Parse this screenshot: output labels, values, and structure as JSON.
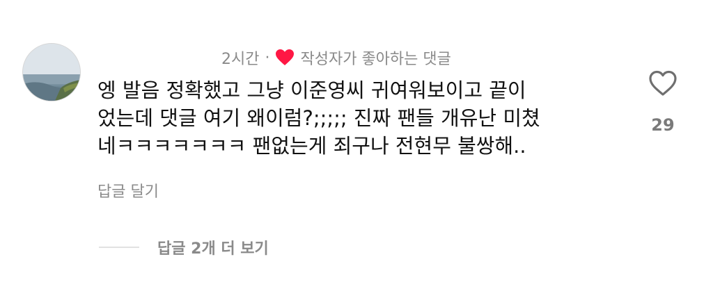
{
  "comment": {
    "time_ago": "2시간",
    "separator": "·",
    "creator_liked_label": "작성자가 좋아하는 댓글",
    "text_lines": [
      "엥 발음 정확했고 그냥 이준영씨 귀여워보이고 끝이",
      "었는데 댓글 여기 왜이럼?;;;;; 진짜 팬들 개유난 미쳤",
      "네ㅋㅋㅋㅋㅋㅋㅋ 팬없는게 죄구나 전현무 불쌍해.."
    ],
    "like_count": "29",
    "reply_label": "답글 달기",
    "view_replies_label": "답글 2개 더 보기"
  },
  "icons": {
    "creator_heart": "heart-filled-icon",
    "like_button": "heart-outline-icon"
  },
  "colors": {
    "creator_heart": "#ff1744",
    "muted_text": "#8a8a8a",
    "body_text": "#111111"
  }
}
